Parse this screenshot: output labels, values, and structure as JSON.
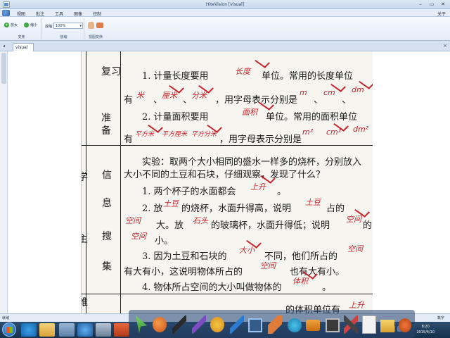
{
  "window": {
    "title": "HiteVision [visual]",
    "controls": [
      "–",
      "▭",
      "✕"
    ]
  },
  "menubar": {
    "items": [
      "视图",
      "批注",
      "工具",
      "图像",
      "控制"
    ],
    "right_label": "关于"
  },
  "ribbon": {
    "zoom_in_label": "放大",
    "zoom_out_label": "缩小",
    "group_transform": "变焦",
    "zoom_field_label": "放缩：",
    "zoom_value": "100%",
    "group_zoom": "放缩",
    "group_view": "视图变换"
  },
  "tab": {
    "label": "visual"
  },
  "document": {
    "side_col1": [
      "学",
      "主",
      "难"
    ],
    "side_col2_review": [
      "复",
      "习",
      "准",
      "备"
    ],
    "side_col2_info": [
      "信",
      "息",
      "搜",
      "集"
    ],
    "lines": [
      "1. 计量长度要用",
      "单位。常用的长度单位",
      "有",
      "、",
      "、",
      "，用字母表示分别是",
      "、",
      "、",
      "2. 计量面积要用",
      "单位。常用的面积单位",
      "有",
      "，用字母表示分别是",
      "实验：取两个大小相同的盛水一样多的烧杯，分别放入",
      "大小不同的土豆和石块，仔细观察，发现了什么？",
      "1. 两个杯子的水面都会",
      "。",
      "2. 放",
      "的烧杯，水面升得高，说明",
      "占的",
      "大。放",
      "的玻璃杯，水面升得低；说明",
      "的",
      "小。",
      "3. 因为土豆和石块的",
      "不同，他们所占的",
      "有大有小，这说明物体所占的",
      "也有大有小。",
      "4. 物体所占空间的大小叫做物体的",
      "。",
      "的体积单位有"
    ],
    "handwriting": [
      "长度",
      "米",
      "厘米",
      "分米",
      "m",
      "cm",
      "dm",
      "面积",
      "平方米",
      "平方厘米",
      "平方分米",
      "m²",
      "cm²",
      "dm²",
      "上升",
      "土豆",
      "土豆",
      "空间",
      "空间",
      "石头",
      "空间",
      "大小",
      "空间",
      "空间",
      "体积",
      "上升"
    ]
  },
  "status": {
    "left": "就绪",
    "right": "数字"
  },
  "taskbar": {
    "time": "8:20",
    "date": "2015/4/10"
  }
}
